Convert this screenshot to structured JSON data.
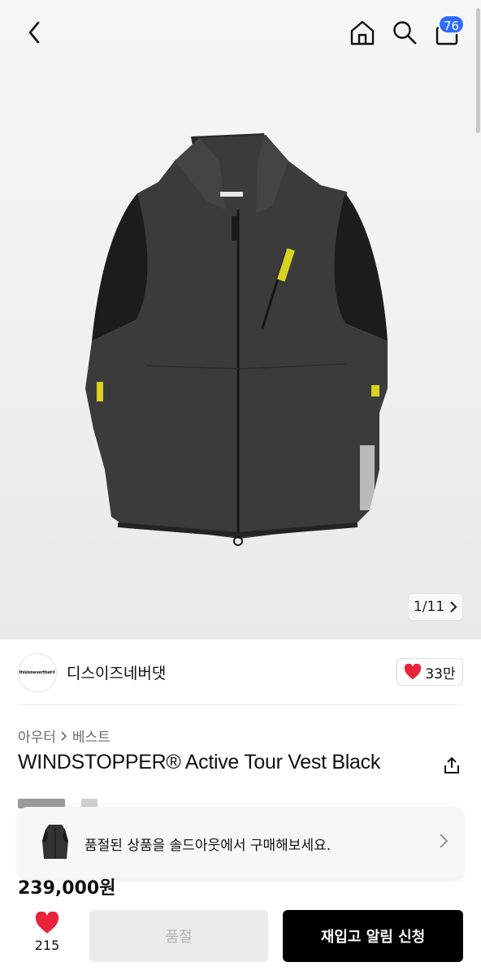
{
  "header": {
    "back_icon": "chevron-left-icon",
    "home_icon": "home-icon",
    "search_icon": "search-icon",
    "cart_icon": "shopping-bag-icon",
    "cart_count": "76"
  },
  "gallery": {
    "counter": "1/11",
    "current_index": 1,
    "total": 11
  },
  "brand": {
    "logo_text": "thisisneverthat®",
    "name": "디스이즈네버댓",
    "likes": "33만"
  },
  "product": {
    "breadcrumb": [
      "아우터",
      "베스트"
    ],
    "title": "WINDSTOPPER® Active Tour Vest Black",
    "price": "239,000원"
  },
  "soldout_banner": {
    "text": "품절된 상품을 솔드아웃에서 구매해보세요."
  },
  "bottom_bar": {
    "wish_count": "215",
    "soldout_label": "품절",
    "restock_label": "재입고 알림 신청"
  },
  "colors": {
    "badge": "#2f6bff",
    "heart": "#e8243b",
    "primary_button": "#000000",
    "disabled_button": "#ebebeb"
  }
}
